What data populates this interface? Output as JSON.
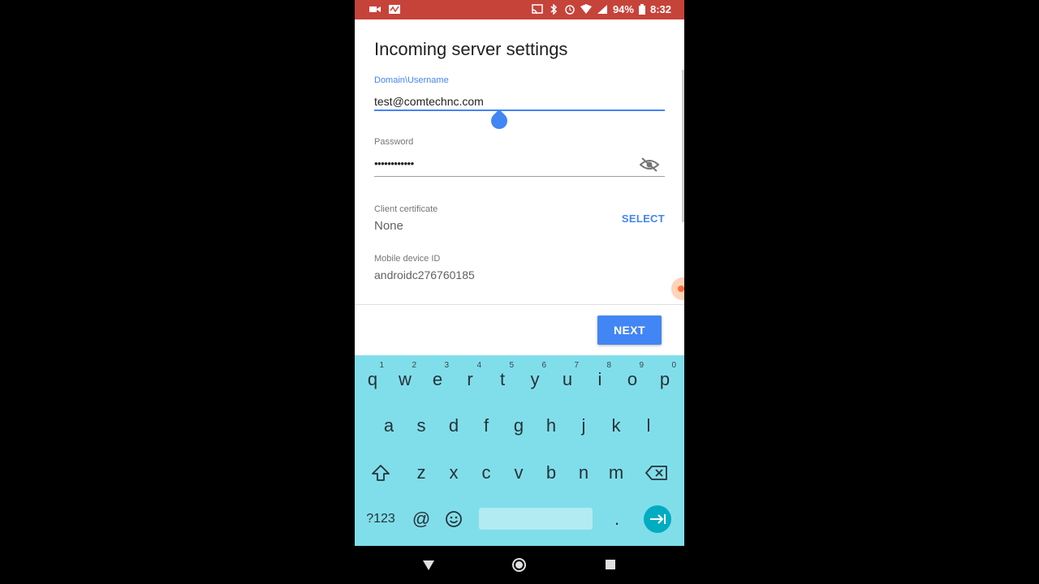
{
  "status_bar": {
    "battery": "94%",
    "time": "8:32",
    "color": "#c6433a"
  },
  "form": {
    "title": "Incoming server settings",
    "domain_username": {
      "label": "Domain\\Username",
      "value": "test@comtechnc.com"
    },
    "password": {
      "label": "Password",
      "value": "••••••••••••"
    },
    "client_certificate": {
      "label": "Client certificate",
      "value": "None",
      "action": "SELECT"
    },
    "mobile_device_id": {
      "label": "Mobile device ID",
      "value": "androidc276760185"
    }
  },
  "next_button": "NEXT",
  "keyboard": {
    "row1": [
      {
        "key": "q",
        "hint": "1"
      },
      {
        "key": "w",
        "hint": "2"
      },
      {
        "key": "e",
        "hint": "3"
      },
      {
        "key": "r",
        "hint": "4"
      },
      {
        "key": "t",
        "hint": "5"
      },
      {
        "key": "y",
        "hint": "6"
      },
      {
        "key": "u",
        "hint": "7"
      },
      {
        "key": "i",
        "hint": "8"
      },
      {
        "key": "o",
        "hint": "9"
      },
      {
        "key": "p",
        "hint": "0"
      }
    ],
    "row2": [
      "a",
      "s",
      "d",
      "f",
      "g",
      "h",
      "j",
      "k",
      "l"
    ],
    "row3": [
      "z",
      "x",
      "c",
      "v",
      "b",
      "n",
      "m"
    ],
    "symbols_key": "?123",
    "at_key": "@",
    "period_key": ".",
    "background": "#80deea",
    "accent": "#00acc1"
  },
  "accent_color": "#4285f4"
}
